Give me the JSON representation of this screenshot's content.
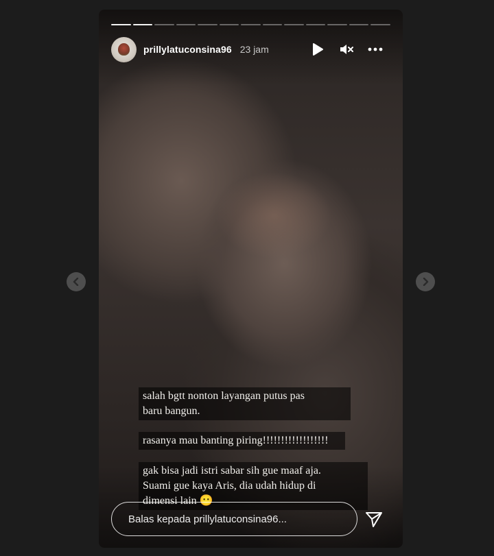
{
  "story": {
    "progress": {
      "segments_total": 13,
      "segments_done": 2
    },
    "user": {
      "username": "prillylatuconsina96",
      "time_ago": "23 jam"
    },
    "controls": {
      "play_icon": "play-icon",
      "mute_icon": "speaker-muted-icon",
      "more_icon": "more-horizontal-icon"
    },
    "captions": [
      "salah bgtt nonton layangan putus pas\nbaru bangun.",
      "rasanya mau banting piring!!!!!!!!!!!!!!!!!!",
      "gak bisa jadi istri sabar sih gue maaf aja.\nSuami gue kaya Aris, dia udah hidup di\ndimensi lain 😶"
    ],
    "reply": {
      "placeholder": "Balas kepada prillylatuconsina96..."
    },
    "send_icon": "send-paper-plane-icon"
  },
  "navigation": {
    "prev_icon": "chevron-left-icon",
    "next_icon": "chevron-right-icon"
  },
  "colors": {
    "page_background": "#1c1c1c",
    "text": "#ffffff",
    "caption_background": "rgba(0,0,0,0.55)"
  }
}
